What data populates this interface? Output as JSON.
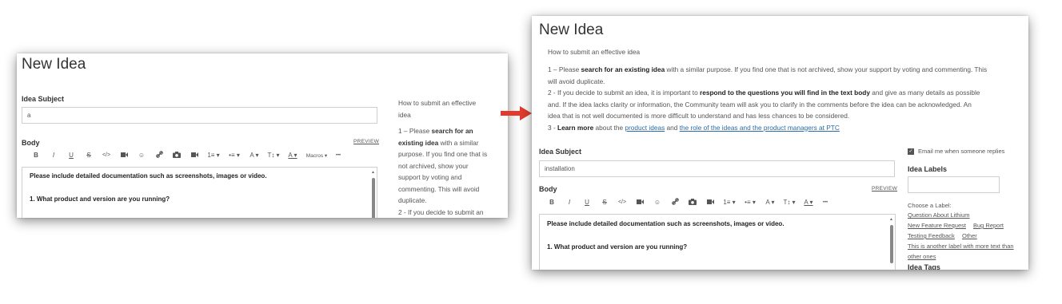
{
  "left": {
    "title": "New Idea",
    "subject_label": "Idea Subject",
    "subject_value": "a",
    "body_label": "Body",
    "preview": "PREVIEW",
    "toolbar": {
      "bold": "B",
      "italic": "I",
      "underline": "U",
      "strike": "S",
      "code": "</>",
      "bullet": "⊙",
      "smile": "☺",
      "link": "⚒",
      "list_num": "1≡ ▾",
      "list_bul": "•≡ ▾",
      "font": "A ▾",
      "size": "T↕ ▾",
      "color": "A ▾",
      "macros": "Macros ▾",
      "more": "•••"
    },
    "editor": {
      "line1": "Please include detailed documentation such as screenshots, images or video.",
      "line2": "1. What product and version are you running?"
    },
    "side": {
      "intro_1": "How to submit an effective",
      "intro_2": "idea",
      "l1": "1 – Please ",
      "l1b": "search for an",
      "l2b": "existing idea",
      "l2": " with a similar",
      "l3": "purpose. If you find one that is",
      "l4": "not archived, show your",
      "l5": "support by voting and",
      "l6": "commenting. This will avoid",
      "l7": "duplicate.",
      "l8": "2 - If you decide to submit an"
    }
  },
  "right": {
    "title": "New Idea",
    "intro": "How to submit an effective idea",
    "p1_a": "1 – Please ",
    "p1_b": "search for an existing idea",
    "p1_c": " with a similar purpose. If you find one that is not archived, show your support by voting and commenting. This",
    "p1_d": "will avoid duplicate.",
    "p2_a": "2 - If you decide to submit an idea, it is important to ",
    "p2_b": "respond to the questions you will find in the text body",
    "p2_c": " and give as many details as possible",
    "p2_d": "and. If the idea lacks clarity or information, the Community team will ask you to clarify in the comments before the idea can be acknowledged. An",
    "p2_e": "idea that is not well documented is more difficult to understand and has less chances to be considered.",
    "p3_a": "3 - ",
    "p3_b": "Learn more",
    "p3_c": " about the ",
    "p3_link1": "product ideas",
    "p3_d": " and ",
    "p3_link2": "the role of the ideas and the product managers at PTC",
    "subject_label": "Idea Subject",
    "subject_value": "installation",
    "body_label": "Body",
    "preview": "PREVIEW",
    "editor": {
      "line1": "Please include detailed documentation such as screenshots, images or video.",
      "line2": "1. What product and version are you running?"
    },
    "email_label": "Email me when someone replies",
    "labels_title": "Idea Labels",
    "choose_label": "Choose a Label:",
    "label_options": [
      "Question About Lithium",
      "New Feature Request",
      "Bug Report",
      "Testing Feedback",
      "Other",
      "This is another label with more text than",
      "other ones"
    ],
    "tags_title": "Idea Tags"
  },
  "colors": {
    "arrow": "#e23b2e",
    "link": "#2a6aa6"
  }
}
